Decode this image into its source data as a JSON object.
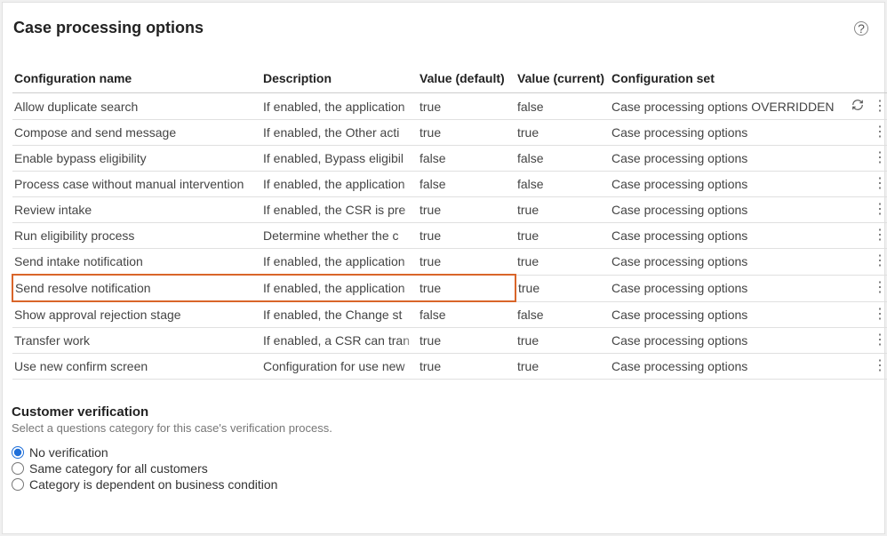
{
  "page": {
    "title": "Case processing options"
  },
  "table": {
    "headers": {
      "name": "Configuration name",
      "desc": "Description",
      "default": "Value (default)",
      "current": "Value (current)",
      "set": "Configuration set"
    },
    "rows": [
      {
        "name": "Allow duplicate search",
        "desc": "If enabled, the application",
        "default": "true",
        "current": "false",
        "set": "Case processing options OVERRIDDEN",
        "refresh": true,
        "highlight": false
      },
      {
        "name": "Compose and send message",
        "desc": "If enabled, the Other acti",
        "default": "true",
        "current": "true",
        "set": "Case processing options",
        "refresh": false,
        "highlight": false
      },
      {
        "name": "Enable bypass eligibility",
        "desc": "If enabled, Bypass eligibil",
        "default": "false",
        "current": "false",
        "set": "Case processing options",
        "refresh": false,
        "highlight": false
      },
      {
        "name": "Process case without manual intervention",
        "desc": "If enabled, the application",
        "default": "false",
        "current": "false",
        "set": "Case processing options",
        "refresh": false,
        "highlight": false
      },
      {
        "name": "Review intake",
        "desc": "If enabled, the CSR is pre",
        "default": "true",
        "current": "true",
        "set": "Case processing options",
        "refresh": false,
        "highlight": false
      },
      {
        "name": "Run eligibility process",
        "desc": "Determine whether the c",
        "default": "true",
        "current": "true",
        "set": "Case processing options",
        "refresh": false,
        "highlight": false
      },
      {
        "name": "Send intake notification",
        "desc": "If enabled, the application",
        "default": "true",
        "current": "true",
        "set": "Case processing options",
        "refresh": false,
        "highlight": false
      },
      {
        "name": "Send resolve notification",
        "desc": "If enabled, the application",
        "default": "true",
        "current": "true",
        "set": "Case processing options",
        "refresh": false,
        "highlight": true
      },
      {
        "name": "Show approval rejection stage",
        "desc": "If enabled, the Change st",
        "default": "false",
        "current": "false",
        "set": "Case processing options",
        "refresh": false,
        "highlight": false
      },
      {
        "name": "Transfer work",
        "desc": "If enabled, a CSR can tran",
        "default": "true",
        "current": "true",
        "set": "Case processing options",
        "refresh": false,
        "highlight": false
      },
      {
        "name": "Use new confirm screen",
        "desc": "Configuration for use new",
        "default": "true",
        "current": "true",
        "set": "Case processing options",
        "refresh": false,
        "highlight": false
      }
    ]
  },
  "verification": {
    "title": "Customer verification",
    "subtitle": "Select a questions category for this case's verification process.",
    "options": [
      {
        "label": "No verification",
        "checked": true
      },
      {
        "label": "Same category for all customers",
        "checked": false
      },
      {
        "label": "Category is dependent on business condition",
        "checked": false
      }
    ]
  }
}
